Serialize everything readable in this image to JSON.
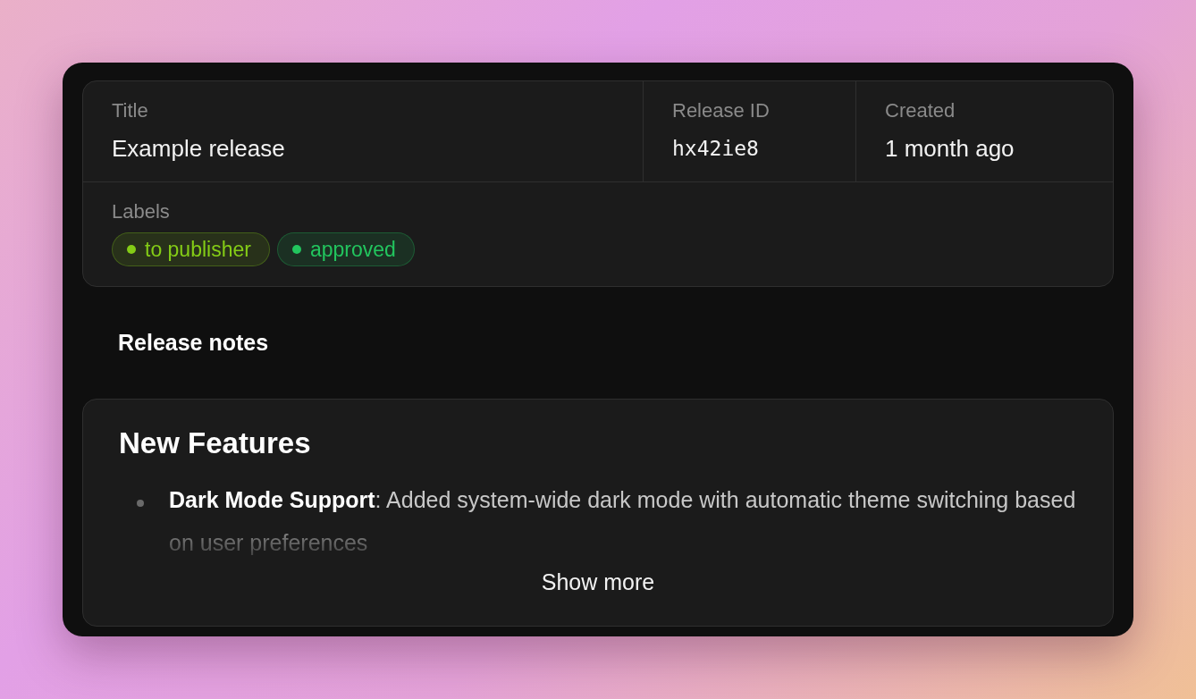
{
  "details": {
    "fields": [
      {
        "label": "Title",
        "value": "Example release",
        "kind": "text"
      },
      {
        "label": "Release ID",
        "value": "hx42ie8",
        "kind": "code"
      },
      {
        "label": "Created",
        "value": "1 month ago",
        "kind": "text"
      }
    ],
    "labels_heading": "Labels",
    "labels": [
      {
        "text": "to publisher",
        "color": "#84cc16"
      },
      {
        "text": "approved",
        "color": "#22c55e"
      }
    ]
  },
  "release_notes": {
    "heading": "Release notes",
    "title": "New Features",
    "items": [
      "**Dark Mode Support**: Added system-wide dark mode with automatic theme switching based on user preferences"
    ],
    "show_more": "Show more"
  }
}
